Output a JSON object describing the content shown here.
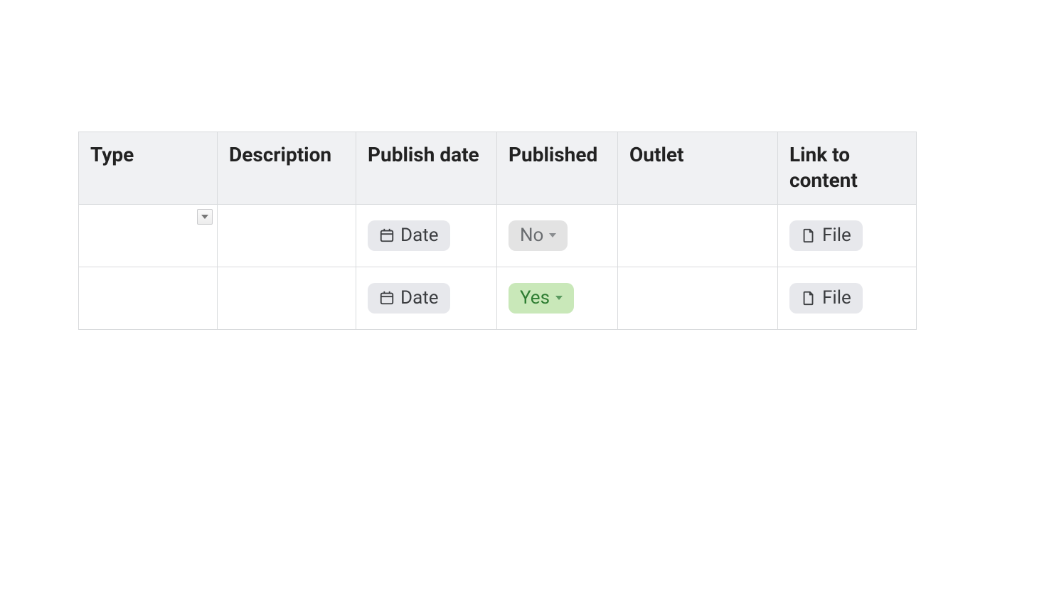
{
  "headers": {
    "type": "Type",
    "description": "Description",
    "publish_date": "Publish date",
    "published": "Published",
    "outlet": "Outlet",
    "link_to_content": "Link to content"
  },
  "rows": [
    {
      "type": "",
      "description": "",
      "publish_date_label": "Date",
      "published_label": "No",
      "published_style": "muted",
      "outlet": "",
      "file_label": "File",
      "show_type_dropdown": true
    },
    {
      "type": "",
      "description": "",
      "publish_date_label": "Date",
      "published_label": "Yes",
      "published_style": "green",
      "outlet": "",
      "file_label": "File",
      "show_type_dropdown": false
    }
  ]
}
